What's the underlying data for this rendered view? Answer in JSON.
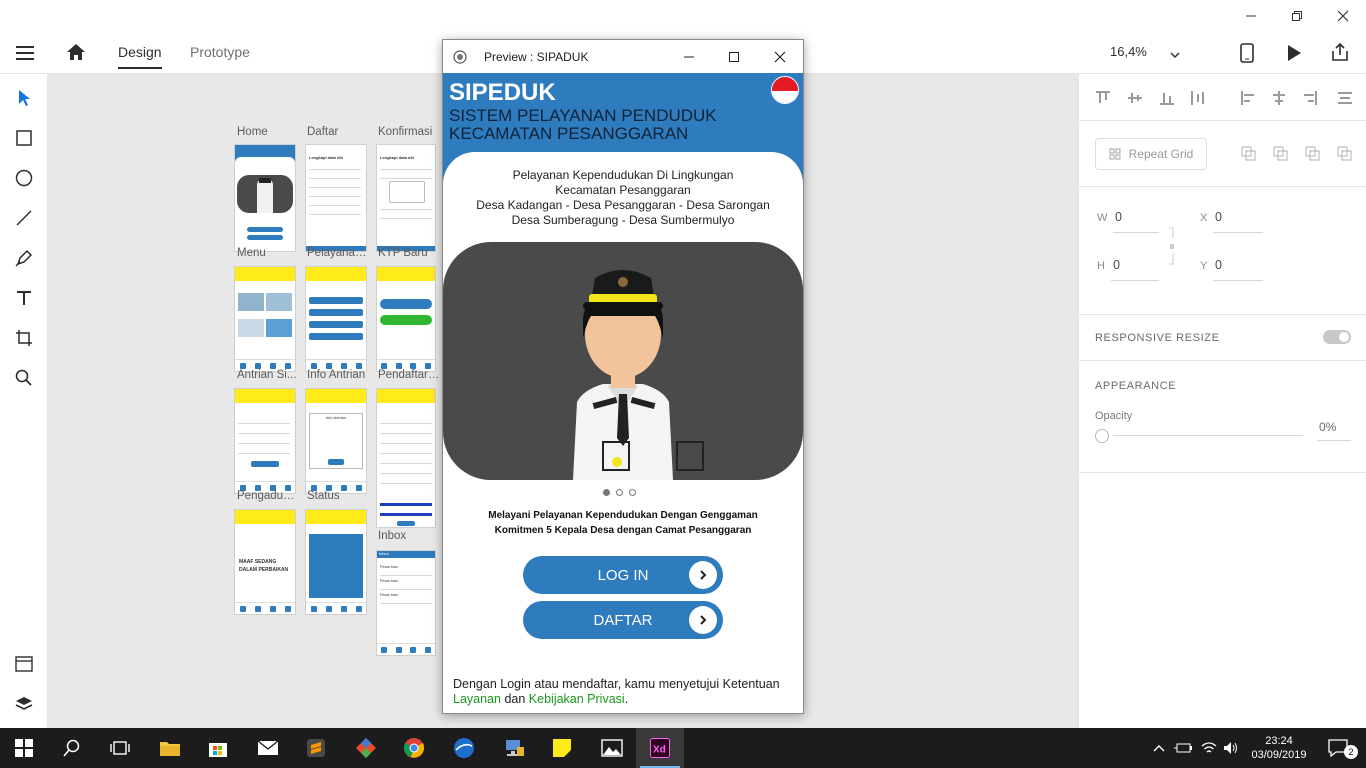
{
  "window": {
    "minimize": "🗕",
    "restore": "🗗",
    "close": "✕"
  },
  "toolbar": {
    "tab_design": "Design",
    "tab_prototype": "Prototype",
    "zoom": "16,4%"
  },
  "canvas": {
    "artboards": [
      "Home",
      "Daftar",
      "Konfirmasi",
      "Menu",
      "Pelayanan ...",
      "KTP Baru",
      "Antrian Si...",
      "Info Antrian",
      "Pendaftara...",
      "Pengadua...",
      "Status",
      "Inbox"
    ],
    "mini": {
      "daftar_title": "Lengkapi data diri",
      "konfirmasi_title": "Lengkapi data diri",
      "pengaduan_line1": "MAAF SEDANG",
      "pengaduan_line2": "DALAM PERBAIKAN",
      "info_title": "Info Antrian",
      "inbox_title": "Inbox",
      "inbox_item": "Pesan baru"
    }
  },
  "right_panel": {
    "repeat_grid": "Repeat Grid",
    "w_label": "W",
    "w_value": "0",
    "x_label": "X",
    "x_value": "0",
    "h_label": "H",
    "h_value": "0",
    "y_label": "Y",
    "y_value": "0",
    "responsive_resize": "RESPONSIVE RESIZE",
    "appearance": "APPEARANCE",
    "opacity_label": "Opacity",
    "opacity_value": "0%"
  },
  "preview": {
    "title": "Preview : SIPADUK",
    "app": {
      "brand": "SIPEDUK",
      "subtitle_1": "SISTEM PELAYANAN PENDUDUK",
      "subtitle_2": "KECAMATAN PESANGGARAN",
      "intro_1": "Pelayanan Kependudukan Di Lingkungan",
      "intro_2": "Kecamatan Pesanggaran",
      "intro_3": "Desa Kadangan - Desa Pesanggaran - Desa Sarongan",
      "intro_4": "Desa Sumberagung - Desa Sumbermulyo",
      "tagline_1": "Melayani Pelayanan Kependudukan Dengan Genggaman",
      "tagline_2": "Komitmen 5 Kepala Desa dengan Camat Pesanggaran",
      "login": "LOG IN",
      "register": "DAFTAR",
      "terms_1": "Dengan Login atau mendaftar, kamu menyetujui Ketentuan",
      "terms_link1": "Layanan",
      "terms_and": "dan",
      "terms_link2": "Kebijakan Privasi",
      "terms_end": "."
    }
  },
  "taskbar": {
    "time": "23:24",
    "date": "03/09/2019",
    "notifications": "2"
  },
  "colors": {
    "app_blue": "#2e7bbd",
    "link_green": "#1a9a1a",
    "flag_red": "#e31b23",
    "xd_pink": "#ff61f6"
  }
}
